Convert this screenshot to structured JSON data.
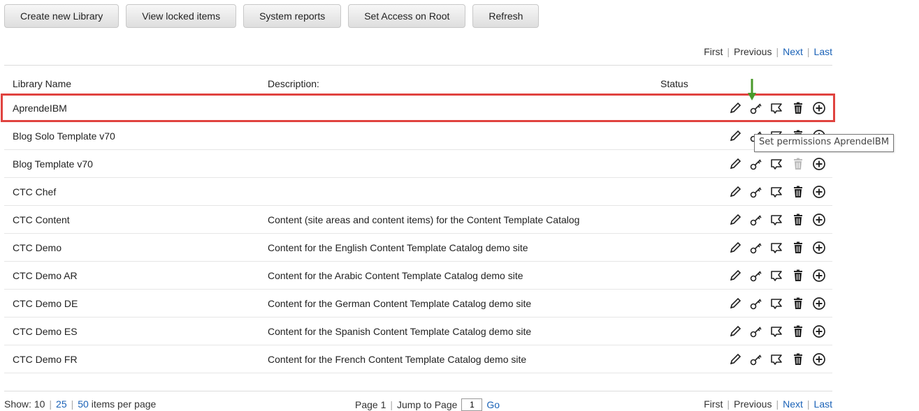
{
  "toolbar": {
    "buttons": [
      {
        "label": "Create new Library"
      },
      {
        "label": "View locked items"
      },
      {
        "label": "System reports"
      },
      {
        "label": "Set Access on Root"
      },
      {
        "label": "Refresh"
      }
    ]
  },
  "pagination": {
    "first": "First",
    "previous": "Previous",
    "next": "Next",
    "last": "Last"
  },
  "table": {
    "columns": {
      "name": "Library Name",
      "description": "Description:",
      "status": "Status"
    },
    "rows": [
      {
        "name": "AprendeIBM",
        "description": "",
        "delete_enabled": true
      },
      {
        "name": "Blog Solo Template v70",
        "description": "",
        "delete_enabled": true
      },
      {
        "name": "Blog Template v70",
        "description": "",
        "delete_enabled": false
      },
      {
        "name": "CTC Chef",
        "description": "",
        "delete_enabled": true
      },
      {
        "name": "CTC Content",
        "description": "Content (site areas and content items) for the Content Template Catalog",
        "delete_enabled": true
      },
      {
        "name": "CTC Demo",
        "description": "Content for the English Content Template Catalog demo site",
        "delete_enabled": true
      },
      {
        "name": "CTC Demo AR",
        "description": "Content for the Arabic Content Template Catalog demo site",
        "delete_enabled": true
      },
      {
        "name": "CTC Demo DE",
        "description": "Content for the German Content Template Catalog demo site",
        "delete_enabled": true
      },
      {
        "name": "CTC Demo ES",
        "description": "Content for the Spanish Content Template Catalog demo site",
        "delete_enabled": true
      },
      {
        "name": "CTC Demo FR",
        "description": "Content for the French Content Template Catalog demo site",
        "delete_enabled": true
      }
    ],
    "row_actions": [
      "edit-icon",
      "key-icon",
      "tag-icon",
      "trash-icon",
      "add-circle-icon"
    ]
  },
  "tooltip": {
    "text": "Set permissions AprendeIBM"
  },
  "annotation": {
    "highlight_color": "#e0433f",
    "arrow_color": "#4a9a2b"
  },
  "footer": {
    "show_label": "Show:",
    "page_size_current": "10",
    "page_size_options": [
      "25",
      "50"
    ],
    "items_per_page": "items per page",
    "page_label": "Page 1",
    "jump_label": "Jump to Page",
    "jump_value": "1",
    "go": "Go"
  }
}
